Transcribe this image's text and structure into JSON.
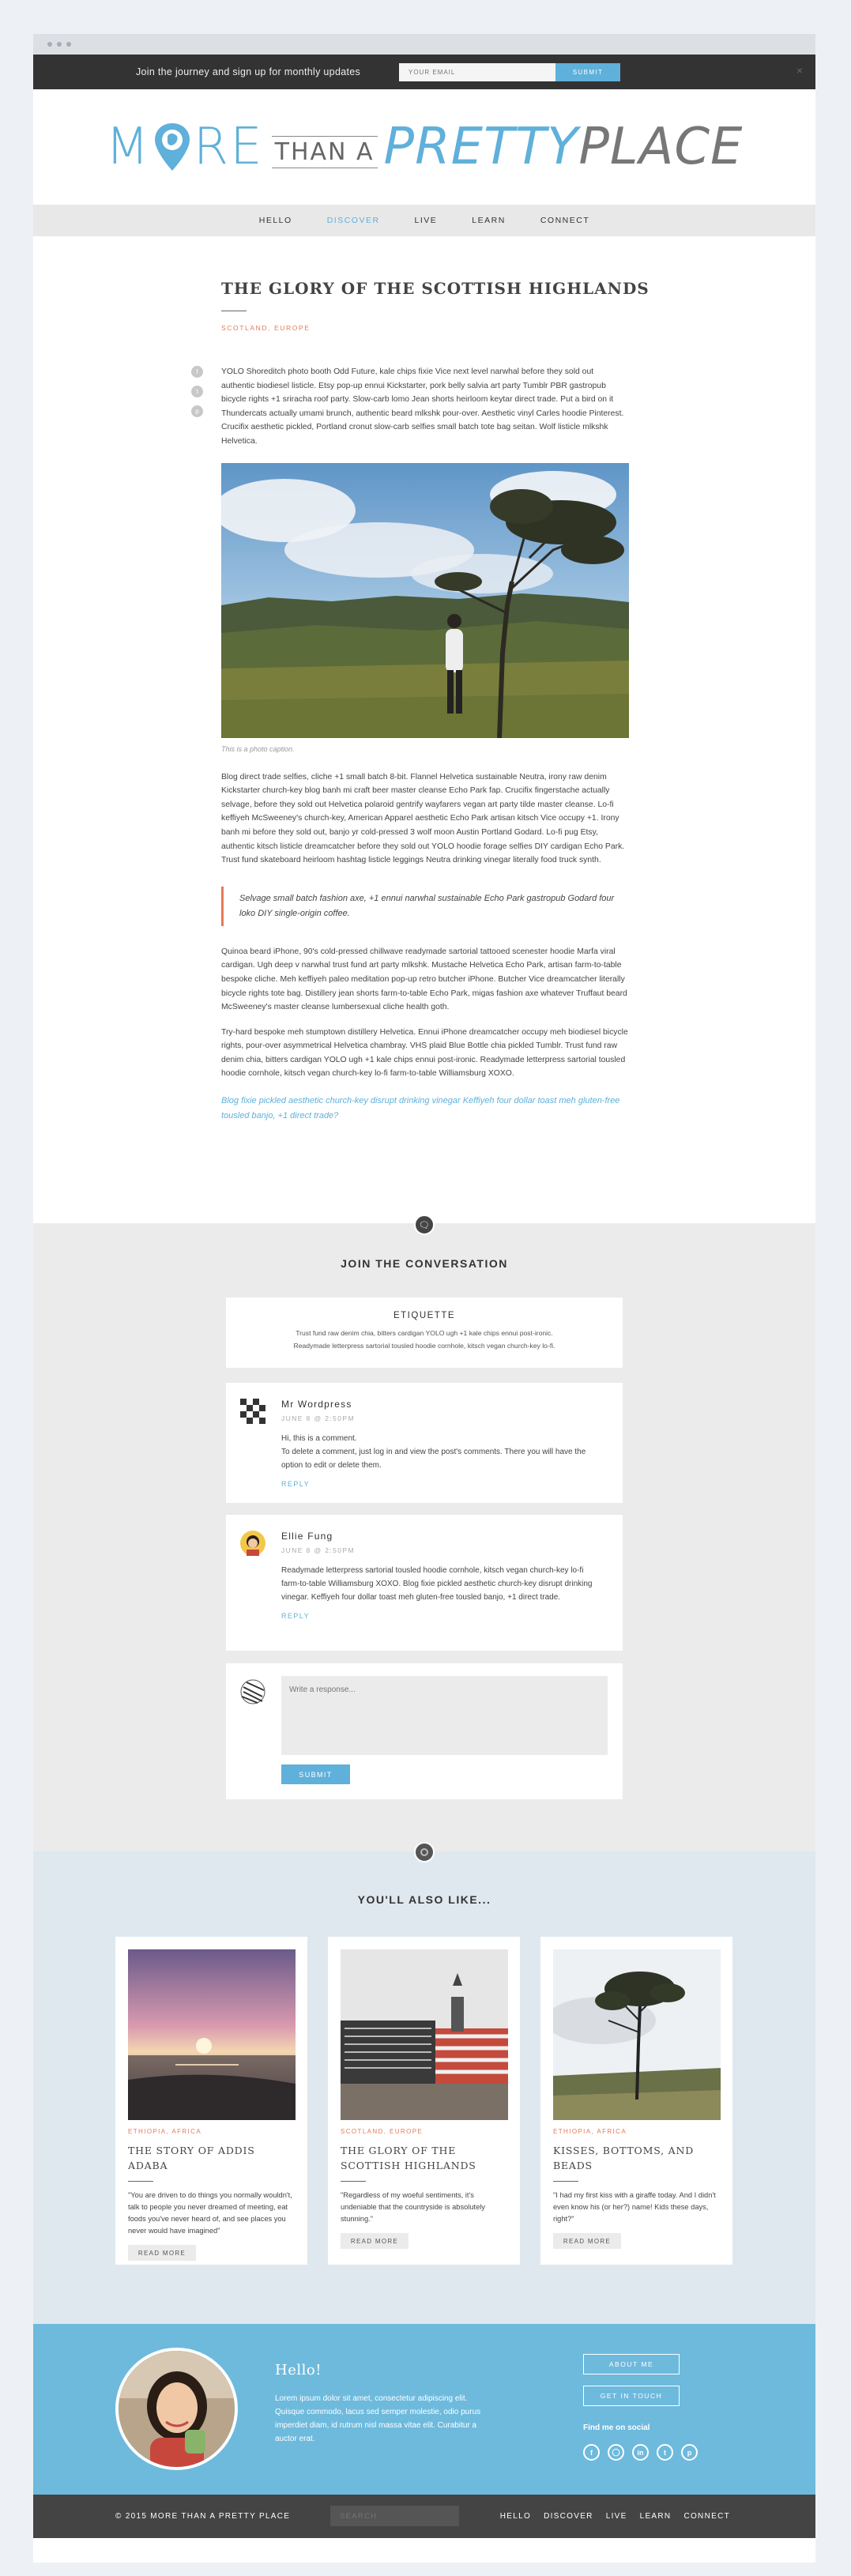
{
  "signup": {
    "text": "Join the journey and sign up for monthly updates",
    "email_placeholder": "YOUR EMAIL",
    "submit_label": "SUBMIT",
    "close": "×"
  },
  "logo": {
    "word_more_m": "M",
    "word_more_rest": "RE",
    "word_than": "THAN A",
    "word_pretty": "PRETTY",
    "word_place": "PLACE"
  },
  "nav": {
    "items": [
      {
        "label": "HELLO"
      },
      {
        "label": "DISCOVER"
      },
      {
        "label": "LIVE"
      },
      {
        "label": "LEARN"
      },
      {
        "label": "CONNECT"
      }
    ],
    "active": "DISCOVER"
  },
  "article": {
    "title": "THE GLORY OF THE SCOTTISH HIGHLANDS",
    "category": "SCOTLAND, EUROPE",
    "share_icons": [
      "facebook-icon",
      "twitter-icon",
      "pinterest-icon"
    ],
    "p1": "YOLO Shoreditch photo booth Odd Future, kale chips fixie Vice next level narwhal before they sold out authentic biodiesel listicle. Etsy pop-up ennui Kickstarter, pork belly salvia art party Tumblr PBR gastropub bicycle rights +1 sriracha roof party. Slow-carb lomo Jean shorts heirloom keytar direct trade. Put a bird on it Thundercats actually umami brunch, authentic beard mlkshk pour-over. Aesthetic vinyl Carles hoodie Pinterest. Crucifix aesthetic pickled, Portland cronut slow-carb selfies small batch tote bag seitan. Wolf listicle mlkshk Helvetica.",
    "caption": "This is a photo caption.",
    "p2": "Blog direct trade selfies, cliche +1 small batch 8-bit. Flannel Helvetica sustainable Neutra, irony raw denim Kickstarter church-key blog banh mi craft beer master cleanse Echo Park fap. Crucifix fingerstache actually selvage, before they sold out Helvetica polaroid gentrify wayfarers vegan art party tilde master cleanse. Lo-fi keffiyeh McSweeney's church-key, American Apparel aesthetic Echo Park artisan kitsch Vice occupy +1. Irony banh mi before they sold out, banjo yr cold-pressed 3 wolf moon Austin Portland Godard. Lo-fi pug Etsy, authentic kitsch listicle dreamcatcher before they sold out YOLO hoodie forage selfies DIY cardigan Echo Park. Trust fund skateboard heirloom hashtag listicle leggings Neutra drinking vinegar literally food truck synth.",
    "quote": "Selvage small batch fashion axe, +1 ennui narwhal sustainable Echo Park gastropub Godard four loko DIY single-origin coffee.",
    "p3": "Quinoa beard iPhone, 90's cold-pressed chillwave readymade sartorial tattooed scenester hoodie Marfa viral cardigan. Ugh deep v narwhal trust fund art party mlkshk. Mustache Helvetica Echo Park, artisan farm-to-table bespoke cliche. Meh keffiyeh paleo meditation pop-up retro butcher iPhone. Butcher Vice dreamcatcher literally bicycle rights tote bag. Distillery jean shorts farm-to-table Echo Park, migas fashion axe whatever Truffaut beard McSweeney's master cleanse lumbersexual cliche health goth.",
    "p4": "Try-hard bespoke meh stumptown distillery Helvetica. Ennui iPhone dreamcatcher occupy meh biodiesel bicycle rights, pour-over asymmetrical Helvetica chambray. VHS plaid Blue Bottle chia pickled Tumblr. Trust fund raw denim chia, bitters cardigan YOLO ugh +1 kale chips ennui post-ironic. Readymade letterpress sartorial tousled hoodie cornhole, kitsch vegan church-key lo-fi farm-to-table Williamsburg XOXO.",
    "link_text": "Blog fixie pickled aesthetic church-key disrupt drinking vinegar Keffiyeh four dollar toast meh gluten-free tousled banjo, +1 direct trade?"
  },
  "conversation": {
    "title": "JOIN THE CONVERSATION",
    "etiquette_title": "ETIQUETTE",
    "etiquette_line1": "Trust fund raw denim chia, bitters cardigan YOLO ugh +1 kale chips ennui post-ironic.",
    "etiquette_line2": "Readymade letterpress sartorial tousled hoodie cornhole, kitsch vegan church-key lo-fi.",
    "comments": [
      {
        "name": "Mr Wordpress",
        "date": "JUNE 8 @ 2:50PM",
        "text1": "Hi, this is a comment.",
        "text2": "To delete a comment, just log in and view the post's comments. There you will have the option to edit or delete them.",
        "reply": "REPLY"
      },
      {
        "name": "Ellie Fung",
        "date": "JUNE 8 @ 2:50PM",
        "text1": "Readymade letterpress sartorial tousled hoodie cornhole, kitsch vegan church-key lo-fi farm-to-table Williamsburg XOXO. Blog fixie pickled aesthetic church-key disrupt drinking vinegar. Keffiyeh four dollar toast meh gluten-free tousled banjo, +1 direct trade.",
        "reply": "REPLY"
      }
    ],
    "response_placeholder": "Write a response...",
    "submit_label": "SUBMIT"
  },
  "also_like": {
    "title": "YOU'LL ALSO LIKE...",
    "posts": [
      {
        "category": "ETHIOPIA, AFRICA",
        "title": "THE STORY OF ADDIS ADABA",
        "excerpt": "\"You are driven to do things you normally wouldn't, talk to people you never dreamed of meeting, eat foods you've never heard of, and see places you never would have imagined\"",
        "button": "READ MORE"
      },
      {
        "category": "SCOTLAND, EUROPE",
        "title": "THE GLORY OF THE SCOTTISH HIGHLANDS",
        "excerpt": "\"Regardless of my woeful sentiments, it's undeniable that the countryside is absolutely stunning.\"",
        "button": "READ MORE"
      },
      {
        "category": "ETHIOPIA, AFRICA",
        "title": "KISSES, BOTTOMS, AND BEADS",
        "excerpt": "\"I had my first kiss with a giraffe today. And I didn't even know his (or her?) name! Kids these days, right?\"",
        "button": "READ MORE"
      }
    ]
  },
  "about": {
    "hello": "Hello!",
    "text": "Lorem ipsum dolor sit amet, consectetur adipiscing elit. Quisque commodo, lacus sed semper molestie, odio purus imperdiet diam, id rutrum nisl massa vitae elit. Curabitur a auctor erat.",
    "about_button": "ABOUT ME",
    "contact_button": "GET IN TOUCH",
    "find_me": "Find me on social",
    "social_icons": [
      "facebook-icon",
      "instagram-icon",
      "linkedin-icon",
      "twitter-icon",
      "pinterest-icon"
    ]
  },
  "footer": {
    "copyright": "© 2015 MORE THAN A PRETTY PLACE",
    "search_placeholder": "SEARCH",
    "nav": [
      {
        "label": "HELLO"
      },
      {
        "label": "DISCOVER"
      },
      {
        "label": "LIVE"
      },
      {
        "label": "LEARN"
      },
      {
        "label": "CONNECT"
      }
    ]
  },
  "colors": {
    "accent_blue": "#5fb0da",
    "accent_orange": "#e67a57",
    "dark": "#333333"
  }
}
